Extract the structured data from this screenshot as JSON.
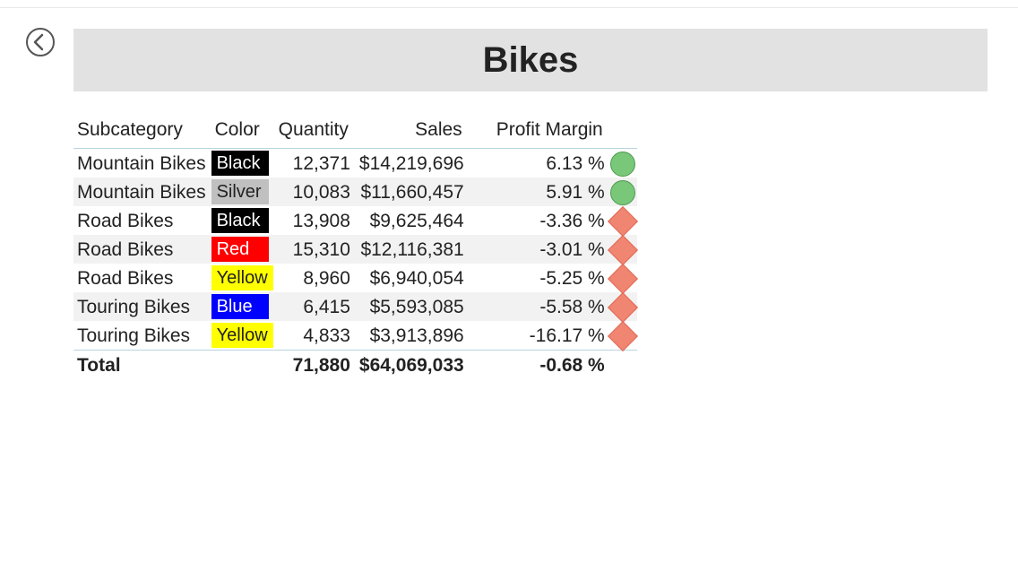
{
  "header": {
    "title": "Bikes"
  },
  "columns": {
    "subcategory": "Subcategory",
    "color": "Color",
    "quantity": "Quantity",
    "sales": "Sales",
    "profit_margin": "Profit Margin"
  },
  "color_styles": {
    "Black": {
      "bg": "#000000",
      "fg": "#ffffff"
    },
    "Silver": {
      "bg": "#c0c0c0",
      "fg": "#222222"
    },
    "Red": {
      "bg": "#ff0000",
      "fg": "#ffffff"
    },
    "Yellow": {
      "bg": "#ffff00",
      "fg": "#222222"
    },
    "Blue": {
      "bg": "#0000ff",
      "fg": "#ffffff"
    }
  },
  "rows": [
    {
      "subcategory": "Mountain Bikes",
      "color": "Black",
      "quantity": "12,371",
      "sales": "$14,219,696",
      "margin": "6.13 %",
      "kpi": "good"
    },
    {
      "subcategory": "Mountain Bikes",
      "color": "Silver",
      "quantity": "10,083",
      "sales": "$11,660,457",
      "margin": "5.91 %",
      "kpi": "good"
    },
    {
      "subcategory": "Road Bikes",
      "color": "Black",
      "quantity": "13,908",
      "sales": "$9,625,464",
      "margin": "-3.36 %",
      "kpi": "bad"
    },
    {
      "subcategory": "Road Bikes",
      "color": "Red",
      "quantity": "15,310",
      "sales": "$12,116,381",
      "margin": "-3.01 %",
      "kpi": "bad"
    },
    {
      "subcategory": "Road Bikes",
      "color": "Yellow",
      "quantity": "8,960",
      "sales": "$6,940,054",
      "margin": "-5.25 %",
      "kpi": "bad"
    },
    {
      "subcategory": "Touring Bikes",
      "color": "Blue",
      "quantity": "6,415",
      "sales": "$5,593,085",
      "margin": "-5.58 %",
      "kpi": "bad"
    },
    {
      "subcategory": "Touring Bikes",
      "color": "Yellow",
      "quantity": "4,833",
      "sales": "$3,913,896",
      "margin": "-16.17 %",
      "kpi": "bad"
    }
  ],
  "totals": {
    "label": "Total",
    "quantity": "71,880",
    "sales": "$64,069,033",
    "margin": "-0.68 %"
  },
  "chart_data": {
    "type": "table",
    "title": "Bikes",
    "columns": [
      "Subcategory",
      "Color",
      "Quantity",
      "Sales",
      "Profit Margin"
    ],
    "rows": [
      [
        "Mountain Bikes",
        "Black",
        12371,
        14219696,
        6.13
      ],
      [
        "Mountain Bikes",
        "Silver",
        10083,
        11660457,
        5.91
      ],
      [
        "Road Bikes",
        "Black",
        13908,
        9625464,
        -3.36
      ],
      [
        "Road Bikes",
        "Red",
        15310,
        12116381,
        -3.01
      ],
      [
        "Road Bikes",
        "Yellow",
        8960,
        6940054,
        -5.25
      ],
      [
        "Touring Bikes",
        "Blue",
        6415,
        5593085,
        -5.58
      ],
      [
        "Touring Bikes",
        "Yellow",
        4833,
        3913896,
        -16.17
      ]
    ],
    "totals": {
      "Quantity": 71880,
      "Sales": 64069033,
      "Profit Margin": -0.68
    }
  }
}
